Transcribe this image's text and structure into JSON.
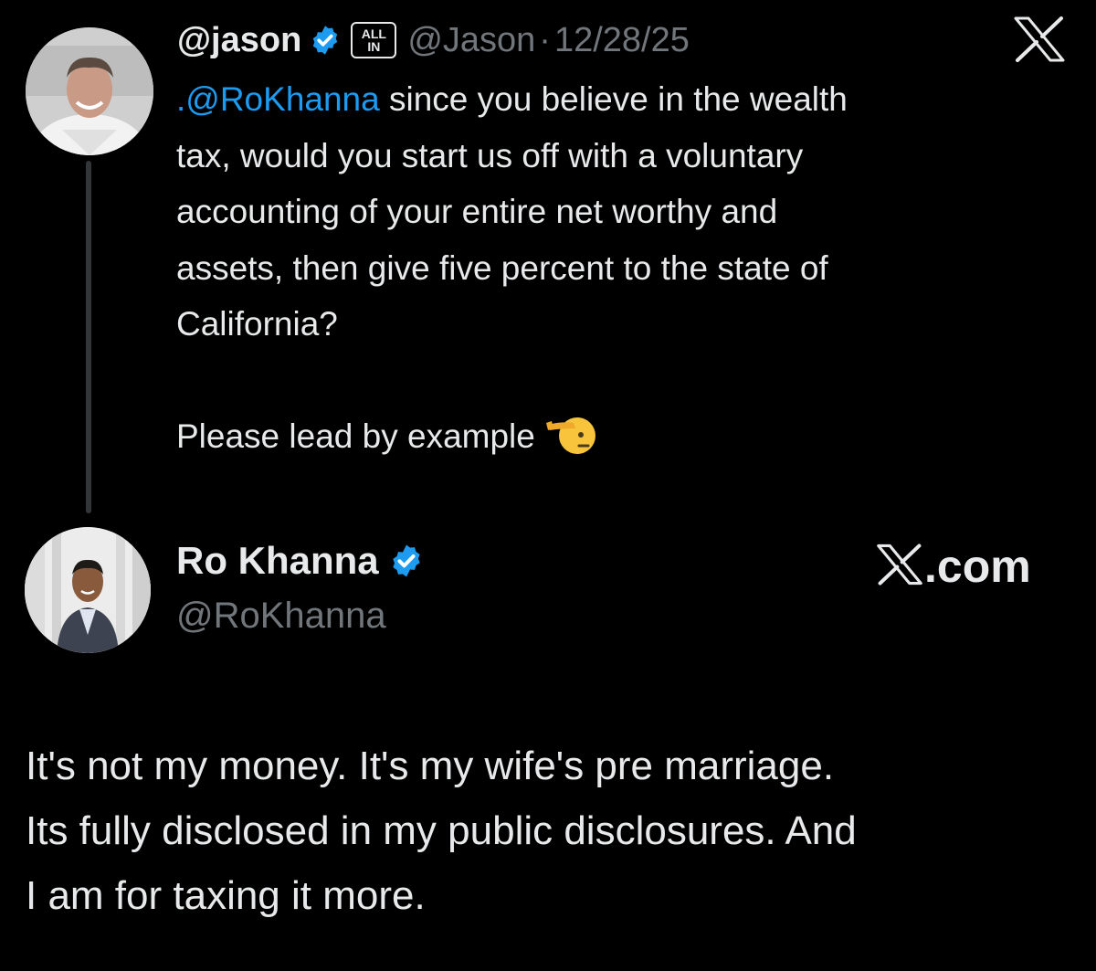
{
  "quoted_tweet": {
    "display_name": "@jason",
    "affiliate_badge": {
      "line1": "ALL",
      "line2": "IN"
    },
    "handle": "@Jason",
    "separator": "·",
    "date": "12/28/25",
    "text_mention": ".@RoKhanna",
    "text_lines": [
      " since you believe in the wealth",
      "tax, would you start us off with a voluntary",
      "accounting of your entire net worthy and",
      "assets, then give five percent to the state of",
      "California?"
    ],
    "text_closing": "Please lead by example",
    "emoji_icon": "saluting-face-emoji"
  },
  "reply_tweet": {
    "display_name": "Ro Khanna",
    "handle": "@RoKhanna",
    "source_label": ".com",
    "text_lines": [
      "It's not my money. It's my wife's pre marriage.",
      "Its fully disclosed in my public disclosures. And",
      "I am for taxing it more."
    ]
  },
  "colors": {
    "background": "#000000",
    "text_primary": "#e7e9ea",
    "text_secondary": "#71767b",
    "mention": "#1d9bf0",
    "verified": "#1d9bf0",
    "thread_line": "#333639"
  }
}
